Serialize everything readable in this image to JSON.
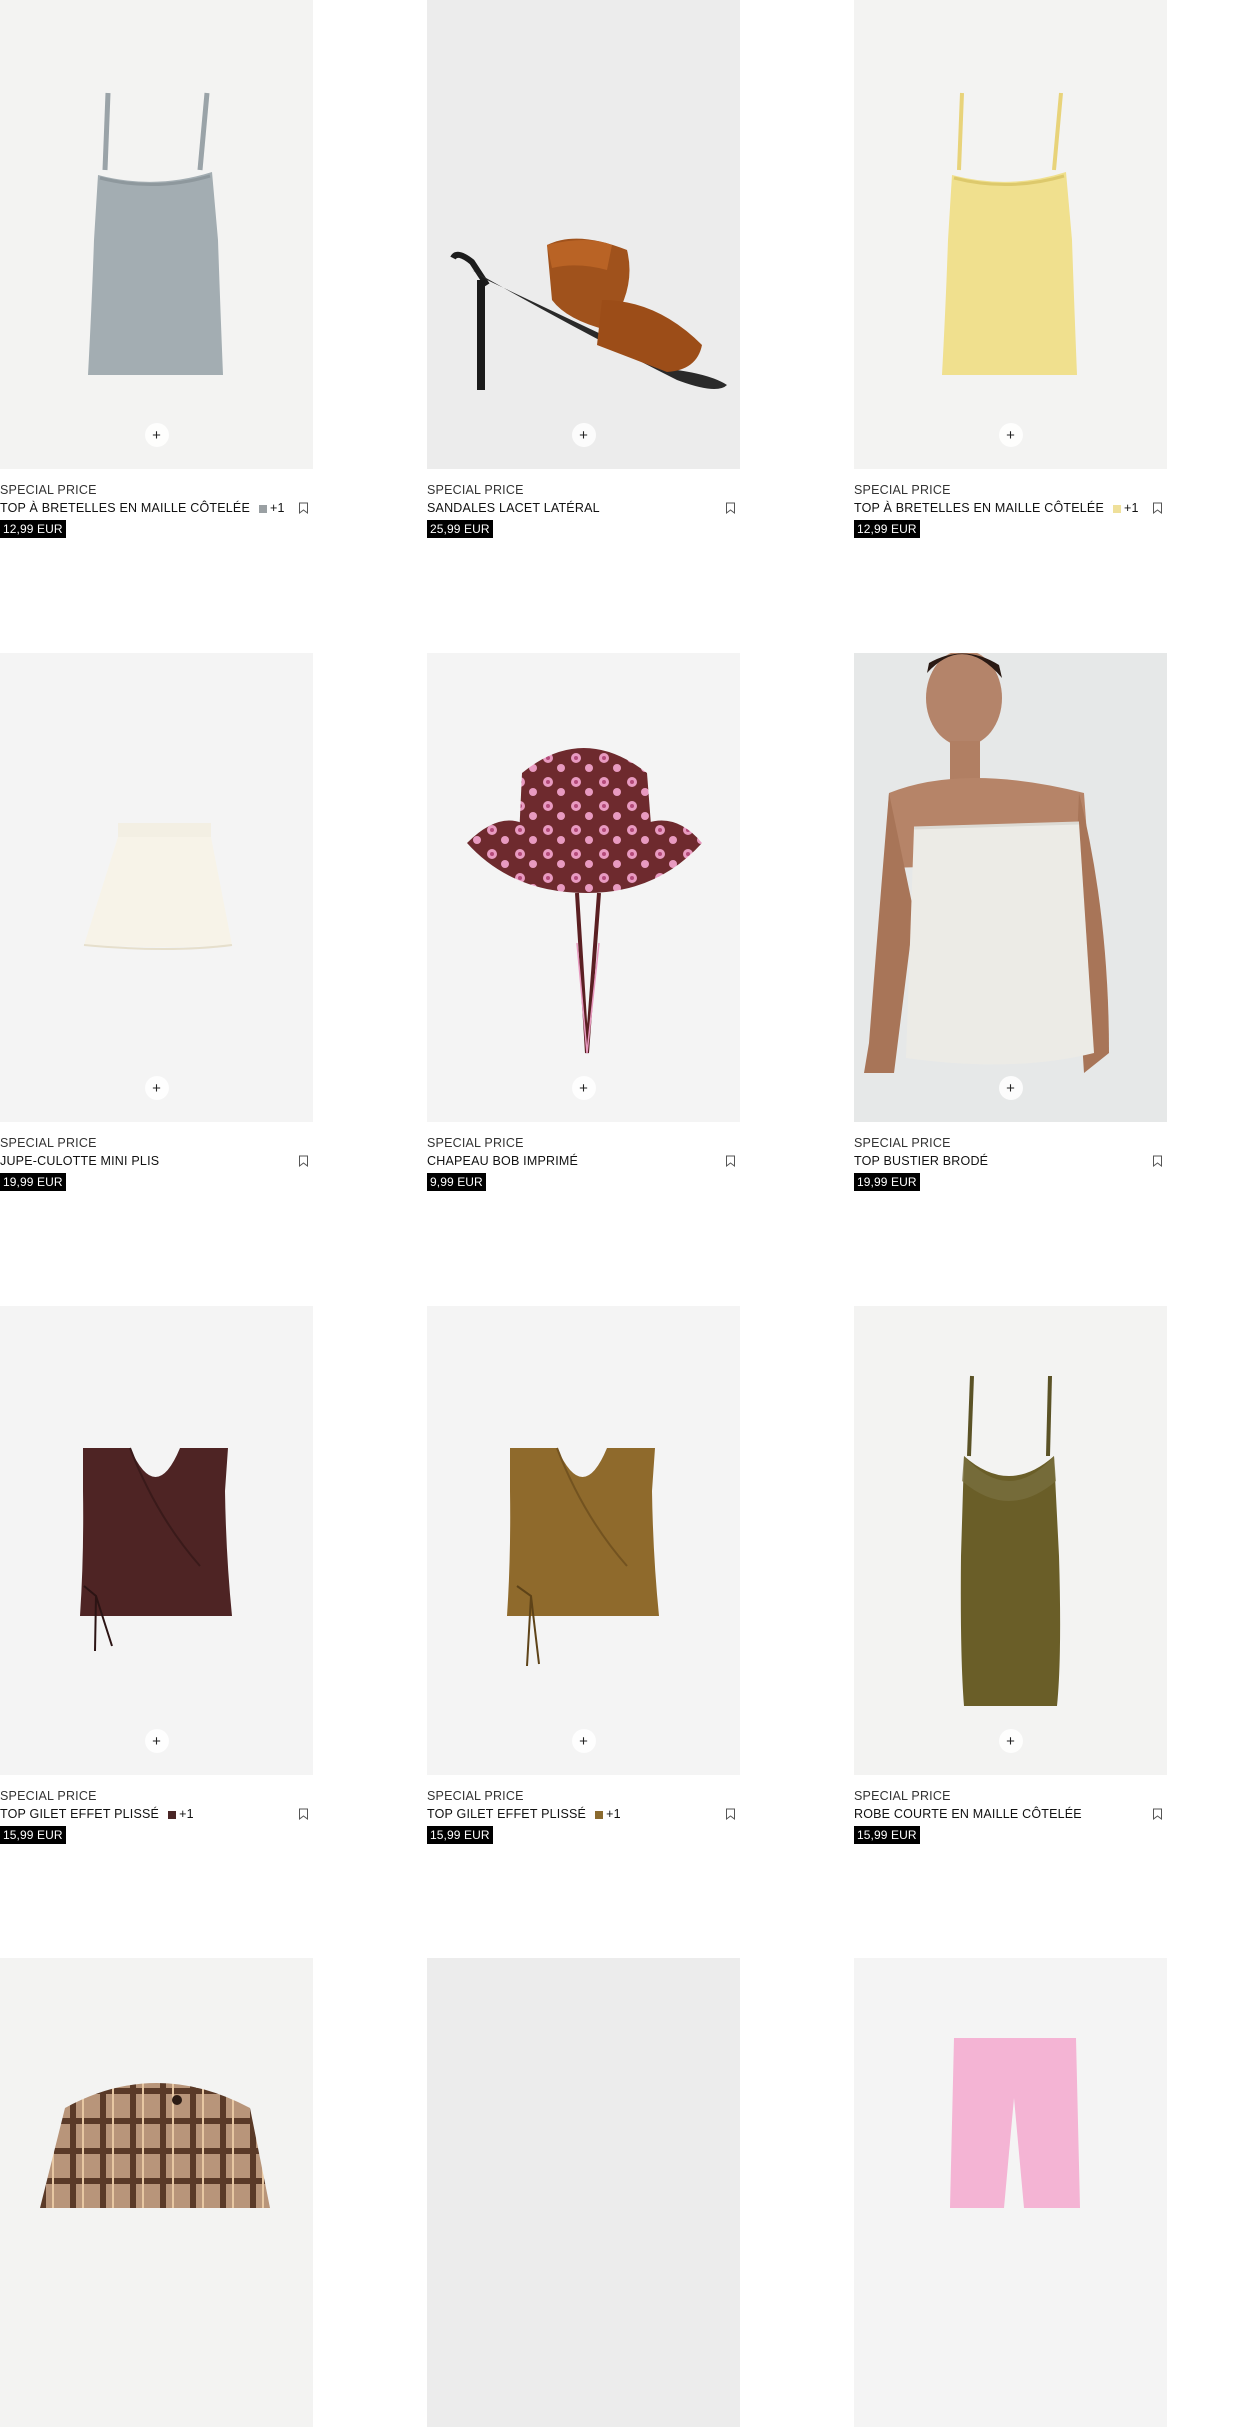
{
  "products": [
    {
      "tag": "SPECIAL PRICE",
      "name": "TOP À BRETELLES EN MAILLE CÔTELÉE",
      "price": "12,99 EUR",
      "swatch": "#9aa0a3",
      "more": "+1",
      "bg": "#f3f3f2",
      "image": "camisole-grey"
    },
    {
      "tag": "SPECIAL PRICE",
      "name": "SANDALES LACET LATÉRAL",
      "price": "25,99 EUR",
      "swatch": "",
      "more": "",
      "bg": "#ececec",
      "image": "heeled-sandal-brown"
    },
    {
      "tag": "SPECIAL PRICE",
      "name": "TOP À BRETELLES EN MAILLE CÔTELÉE",
      "price": "12,99 EUR",
      "swatch": "#efe09a",
      "more": "+1",
      "bg": "#f3f3f2",
      "image": "camisole-yellow"
    },
    {
      "tag": "SPECIAL PRICE",
      "name": "JUPE-CULOTTE MINI PLIS",
      "price": "19,99 EUR",
      "swatch": "",
      "more": "",
      "bg": "#f4f4f4",
      "image": "skort-white"
    },
    {
      "tag": "SPECIAL PRICE",
      "name": "CHAPEAU BOB IMPRIMÉ",
      "price": "9,99 EUR",
      "swatch": "",
      "more": "",
      "bg": "#f4f4f4",
      "image": "bucket-hat-floral"
    },
    {
      "tag": "SPECIAL PRICE",
      "name": "TOP BUSTIER BRODÉ",
      "price": "19,99 EUR",
      "swatch": "",
      "more": "",
      "bg": "#e6e8e8",
      "image": "model-bustier-top"
    },
    {
      "tag": "SPECIAL PRICE",
      "name": "TOP GILET EFFET PLISSÉ",
      "price": "15,99 EUR",
      "swatch": "#4a2626",
      "more": "+1",
      "bg": "#f4f4f4",
      "image": "vest-burgundy"
    },
    {
      "tag": "SPECIAL PRICE",
      "name": "TOP GILET EFFET PLISSÉ",
      "price": "15,99 EUR",
      "swatch": "#8a6a2e",
      "more": "+1",
      "bg": "#f4f4f4",
      "image": "vest-mustard"
    },
    {
      "tag": "SPECIAL PRICE",
      "name": "ROBE COURTE EN MAILLE CÔTELÉE",
      "price": "15,99 EUR",
      "swatch": "",
      "more": "",
      "bg": "#f3f3f2",
      "image": "slip-dress-olive"
    },
    {
      "tag": "",
      "name": "",
      "price": "",
      "swatch": "",
      "more": "",
      "bg": "#f3f3f2",
      "image": "plaid-jacket"
    },
    {
      "tag": "",
      "name": "",
      "price": "",
      "swatch": "",
      "more": "",
      "bg": "#ececec",
      "image": "blank"
    },
    {
      "tag": "",
      "name": "",
      "price": "",
      "swatch": "",
      "more": "",
      "bg": "#f4f4f4",
      "image": "pink-pants"
    }
  ],
  "ui": {
    "add_label": "+",
    "icons": {
      "add": "plus-icon",
      "save": "bookmark-icon"
    }
  }
}
